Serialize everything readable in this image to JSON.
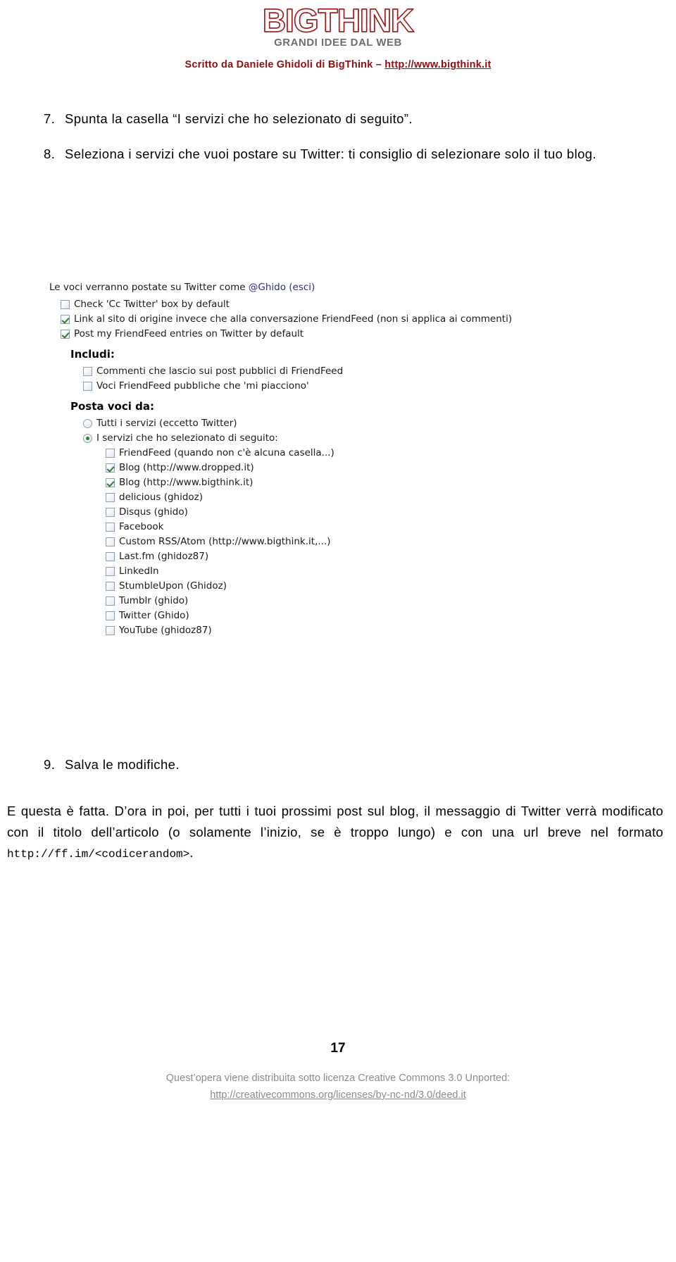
{
  "header": {
    "logo_main": "BIGTHINK",
    "logo_sub": "GRANDI IDEE DAL WEB",
    "byline_prefix": "Scritto da Daniele Ghidoli di BigThink – ",
    "byline_url": "http://www.bigthink.it",
    "logo_color": "#9e1b1b",
    "byline_color": "#8d0f12"
  },
  "steps": [
    {
      "num": "7.",
      "text": "Spunta la casella “I servizi che ho selezionato di seguito”."
    },
    {
      "num": "8.",
      "text": "Seleziona i servizi che vuoi postare su Twitter: ti consiglio di selezionare solo il tuo blog."
    }
  ],
  "screenshot": {
    "intro_prefix": "Le voci verranno postate su Twitter come ",
    "intro_handle": "@Ghido",
    "intro_logout": "(esci)",
    "link_color": "#2a2a8c",
    "top_options": [
      {
        "label": "Check 'Cc Twitter' box by default",
        "checked": false
      },
      {
        "label": "Link al sito di origine invece che alla conversazione FriendFeed (non si applica ai commenti)",
        "checked": true
      },
      {
        "label": "Post my FriendFeed entries on Twitter by default",
        "checked": true
      }
    ],
    "includi_title": "Includi:",
    "includi_options": [
      {
        "label": "Commenti che lascio sui post pubblici di FriendFeed",
        "checked": false
      },
      {
        "label": "Voci FriendFeed pubbliche che 'mi piacciono'",
        "checked": false
      }
    ],
    "posta_title": "Posta voci da:",
    "posta_radios": [
      {
        "label": "Tutti i servizi (eccetto Twitter)",
        "selected": false
      },
      {
        "label": "I servizi che ho selezionato di seguito:",
        "selected": true
      }
    ],
    "services": [
      {
        "label": "FriendFeed (quando non c'è alcuna casella...)",
        "checked": false
      },
      {
        "label": "Blog (http://www.dropped.it)",
        "checked": true
      },
      {
        "label": "Blog (http://www.bigthink.it)",
        "checked": true
      },
      {
        "label": "delicious (ghidoz)",
        "checked": false
      },
      {
        "label": "Disqus (ghido)",
        "checked": false
      },
      {
        "label": "Facebook",
        "checked": false
      },
      {
        "label": "Custom RSS/Atom (http://www.bigthink.it,...)",
        "checked": false
      },
      {
        "label": "Last.fm (ghidoz87)",
        "checked": false
      },
      {
        "label": "LinkedIn",
        "checked": false
      },
      {
        "label": "StumbleUpon (Ghidoz)",
        "checked": false
      },
      {
        "label": "Tumblr (ghido)",
        "checked": false
      },
      {
        "label": "Twitter (Ghido)",
        "checked": false
      },
      {
        "label": "YouTube (ghidoz87)",
        "checked": false
      }
    ]
  },
  "step9": {
    "num": "9.",
    "text": "Salva le modifiche."
  },
  "closing": {
    "part1": "E questa è fatta. D’ora in poi, per tutti i tuoi prossimi post sul blog, il messaggio di Twitter verrà modificato con il titolo dell’articolo (o solamente l’inizio, se è troppo lungo) e con una url breve nel formato ",
    "url": "http://ff.im/<codicerandom>",
    "part2": "."
  },
  "footer": {
    "page_number": "17",
    "license_text": "Quest’opera viene distribuita sotto licenza Creative Commons 3.0 Unported:",
    "license_url": "http://creativecommons.org/licenses/by-nc-nd/3.0/deed.it",
    "license_color": "#8c8c8c"
  }
}
